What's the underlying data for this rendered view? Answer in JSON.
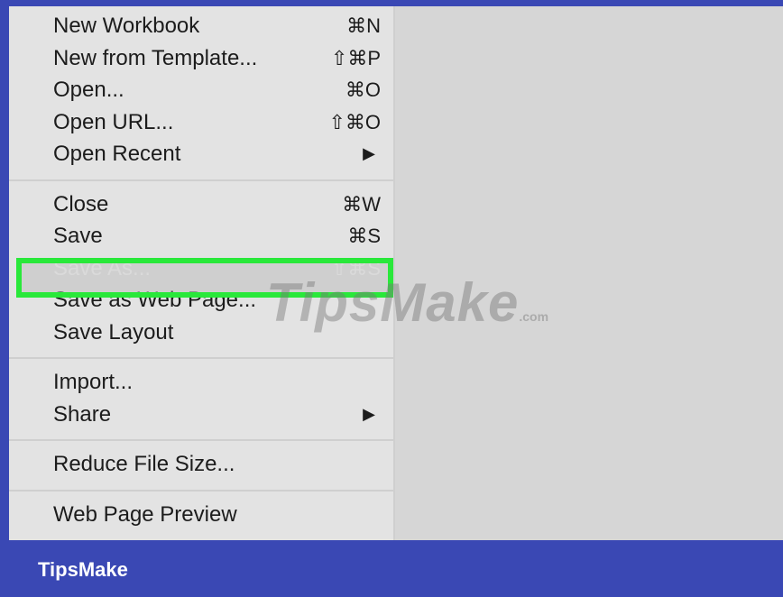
{
  "menu": {
    "groups": [
      [
        {
          "label": "New Workbook",
          "shortcut": "⌘N"
        },
        {
          "label": "New from Template...",
          "shortcut": "⇧⌘P"
        },
        {
          "label": "Open...",
          "shortcut": "⌘O"
        },
        {
          "label": "Open URL...",
          "shortcut": "⇧⌘O"
        },
        {
          "label": "Open Recent",
          "shortcut": "▶"
        }
      ],
      [
        {
          "label": "Close",
          "shortcut": "⌘W"
        },
        {
          "label": "Save",
          "shortcut": "⌘S"
        },
        {
          "label": "Save As...",
          "shortcut": "⇧⌘S"
        },
        {
          "label": "Save as Web Page...",
          "shortcut": ""
        },
        {
          "label": "Save Layout",
          "shortcut": ""
        }
      ],
      [
        {
          "label": "Import...",
          "shortcut": ""
        },
        {
          "label": "Share",
          "shortcut": "▶"
        }
      ],
      [
        {
          "label": "Reduce File Size...",
          "shortcut": ""
        }
      ],
      [
        {
          "label": "Web Page Preview",
          "shortcut": ""
        }
      ]
    ]
  },
  "watermark": {
    "text": "TipsMake",
    "suffix": ".com"
  },
  "brand": {
    "label": "TipsMake"
  },
  "colors": {
    "highlight_border": "#29e83a",
    "brand_bar": "#3a48b4"
  }
}
